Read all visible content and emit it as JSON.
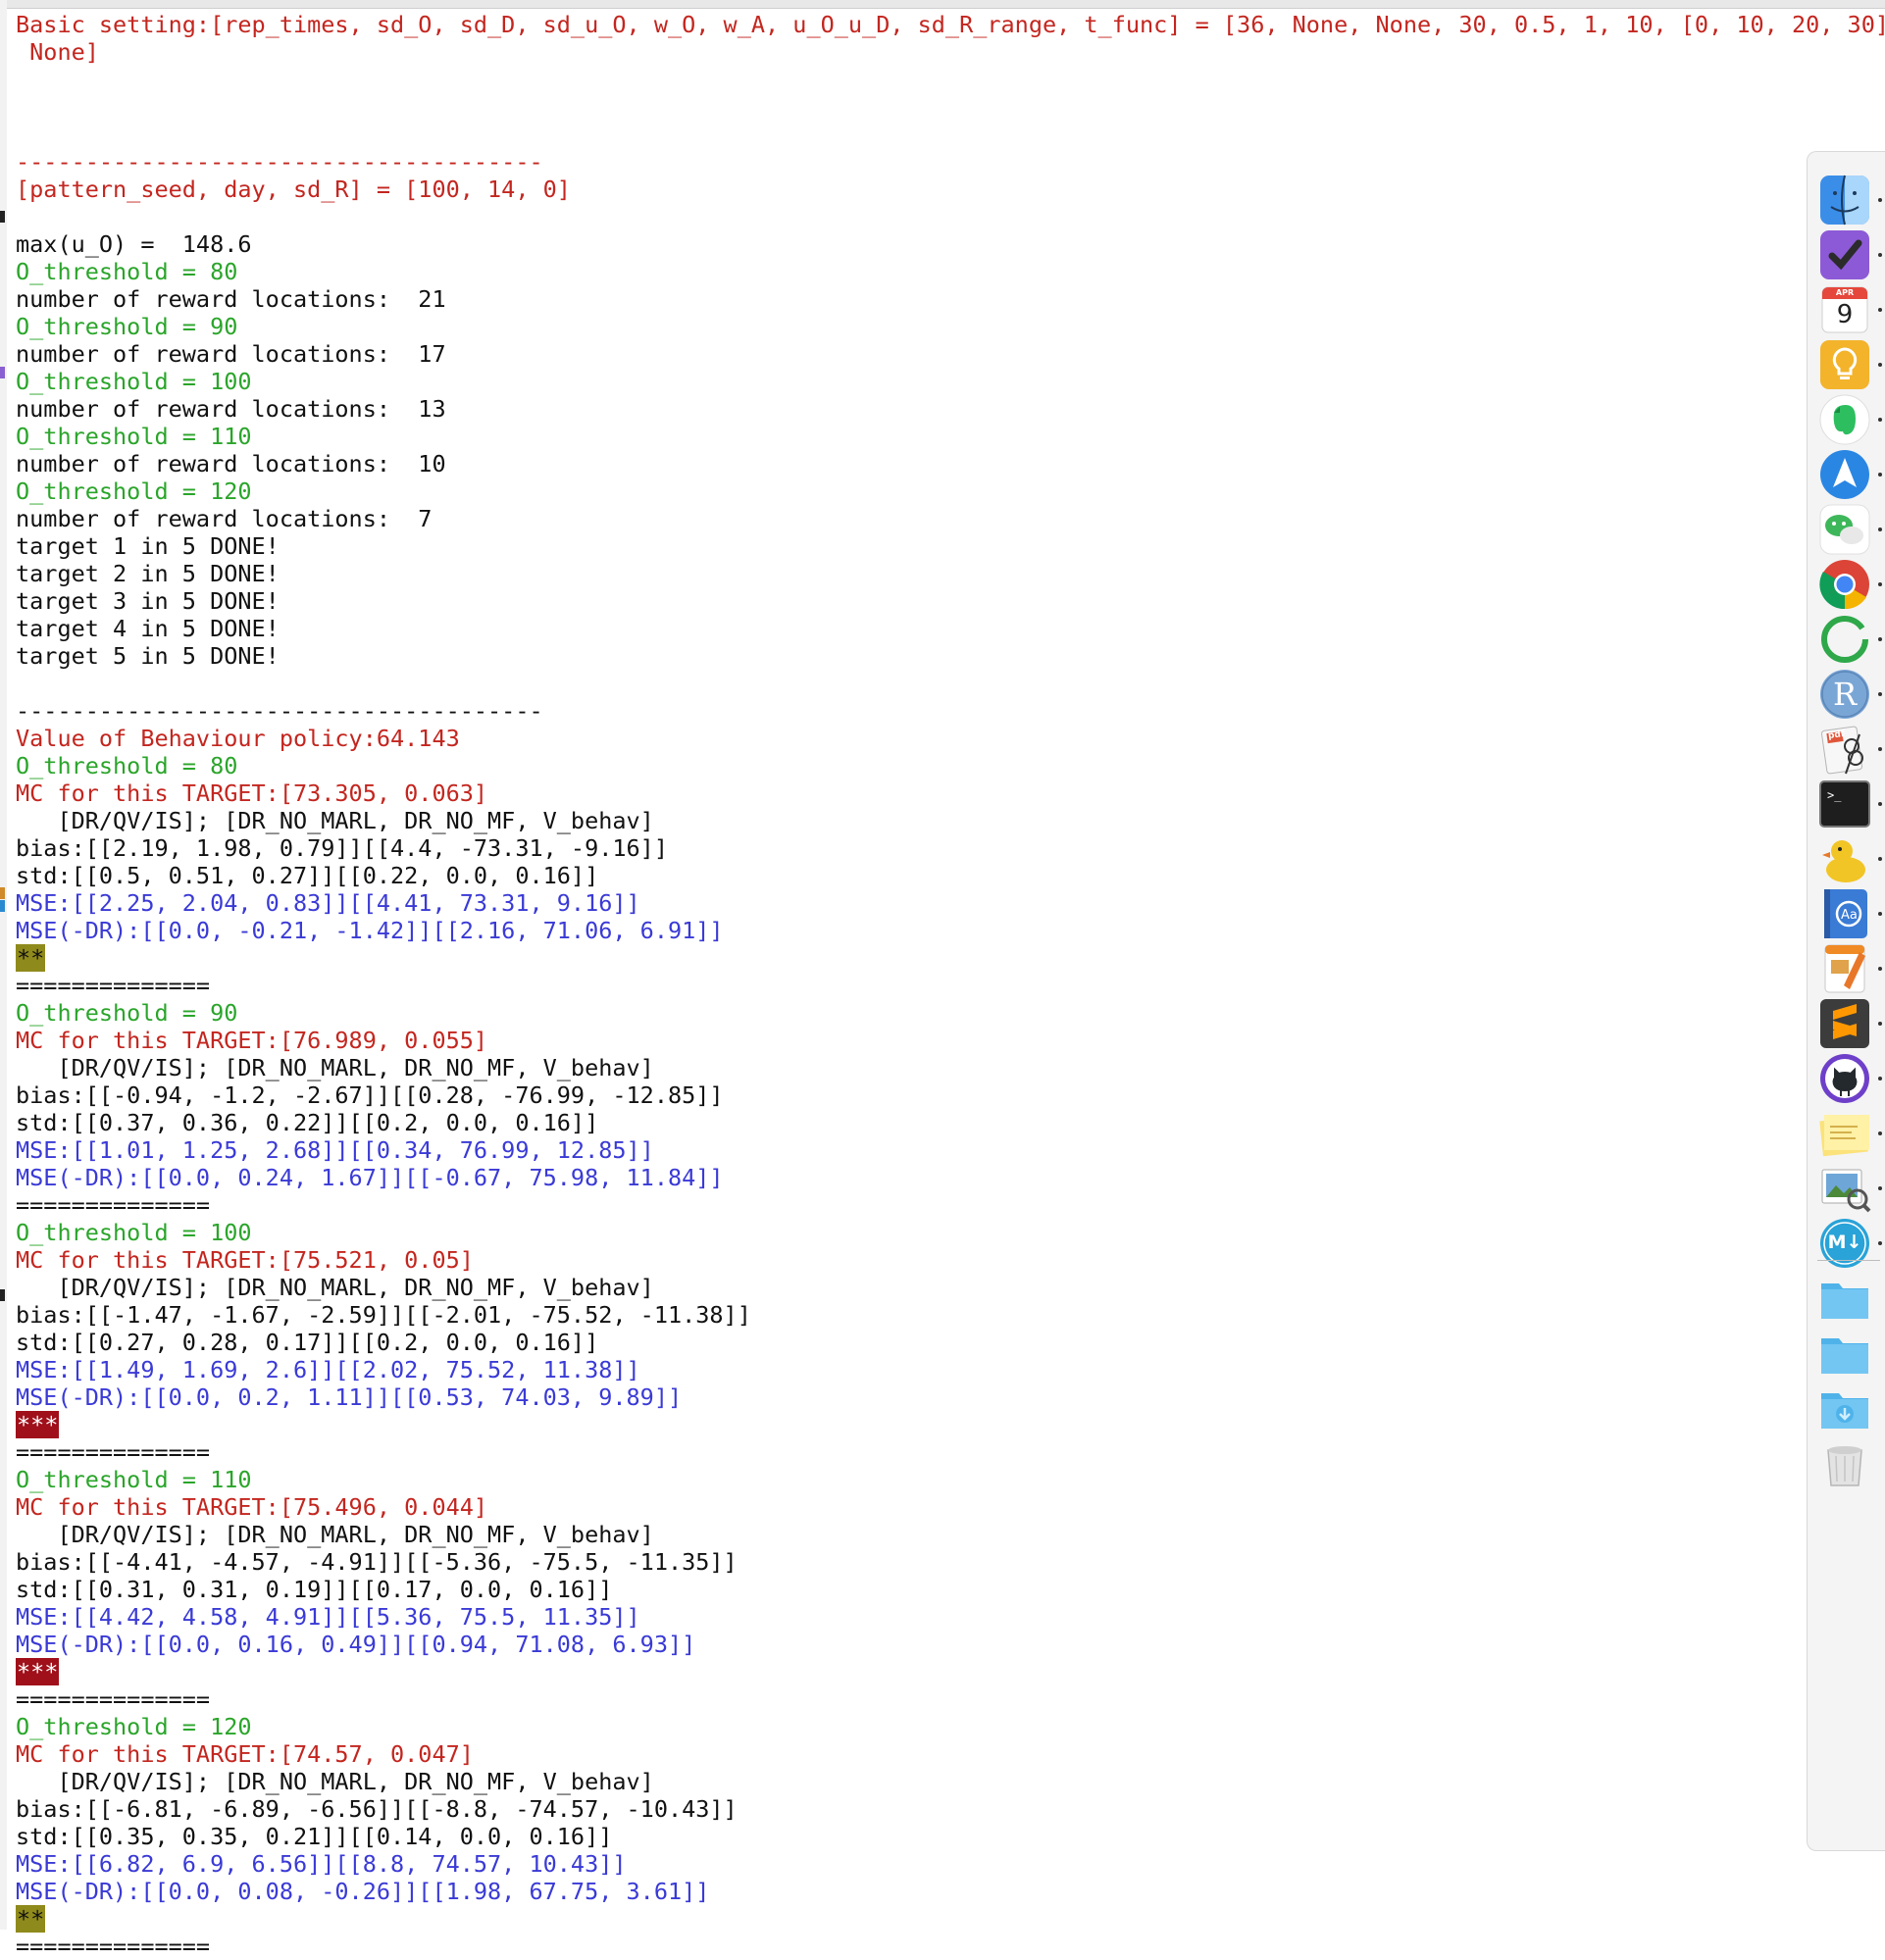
{
  "console": {
    "lines": [
      {
        "text": "Basic setting:[rep_times, sd_O, sd_D, sd_u_O, w_O, w_A, u_O_u_D, sd_R_range, t_func] = [36, None, None, 30, 0.5, 1, 10, [0, 10, 20, 30],",
        "color": "red"
      },
      {
        "text": " None]",
        "color": "red"
      },
      {
        "text": "",
        "color": "black"
      },
      {
        "text": "",
        "color": "black"
      },
      {
        "text": "",
        "color": "black"
      },
      {
        "text": "--------------------------------------",
        "color": "red"
      },
      {
        "text": "[pattern_seed, day, sd_R] = [100, 14, 0]",
        "color": "red"
      },
      {
        "text": "",
        "color": "black"
      },
      {
        "text": "max(u_O) =  148.6",
        "color": "black"
      },
      {
        "text": "O_threshold = 80",
        "color": "green"
      },
      {
        "text": "number of reward locations:  21",
        "color": "black"
      },
      {
        "text": "O_threshold = 90",
        "color": "green"
      },
      {
        "text": "number of reward locations:  17",
        "color": "black"
      },
      {
        "text": "O_threshold = 100",
        "color": "green"
      },
      {
        "text": "number of reward locations:  13",
        "color": "black"
      },
      {
        "text": "O_threshold = 110",
        "color": "green"
      },
      {
        "text": "number of reward locations:  10",
        "color": "black"
      },
      {
        "text": "O_threshold = 120",
        "color": "green"
      },
      {
        "text": "number of reward locations:  7",
        "color": "black"
      },
      {
        "text": "target 1 in 5 DONE!",
        "color": "black"
      },
      {
        "text": "target 2 in 5 DONE!",
        "color": "black"
      },
      {
        "text": "target 3 in 5 DONE!",
        "color": "black"
      },
      {
        "text": "target 4 in 5 DONE!",
        "color": "black"
      },
      {
        "text": "target 5 in 5 DONE!",
        "color": "black"
      },
      {
        "text": "",
        "color": "black"
      },
      {
        "text": "--------------------------------------",
        "color": "black"
      },
      {
        "text": "Value of Behaviour policy:64.143",
        "color": "red"
      },
      {
        "text": "O_threshold = 80",
        "color": "green"
      },
      {
        "text": "MC for this TARGET:[73.305, 0.063]",
        "color": "red"
      },
      {
        "text": "   [DR/QV/IS]; [DR_NO_MARL, DR_NO_MF, V_behav]",
        "color": "black"
      },
      {
        "text": "bias:[[2.19, 1.98, 0.79]][[4.4, -73.31, -9.16]]",
        "color": "black"
      },
      {
        "text": "std:[[0.5, 0.51, 0.27]][[0.22, 0.0, 0.16]]",
        "color": "black"
      },
      {
        "text": "MSE:[[2.25, 2.04, 0.83]][[4.41, 73.31, 9.16]]",
        "color": "blue"
      },
      {
        "text": "MSE(-DR):[[0.0, -0.21, -1.42]][[2.16, 71.06, 6.91]]",
        "color": "blue"
      },
      {
        "text": "**",
        "color": "star-olive"
      },
      {
        "text": "==============",
        "color": "black"
      },
      {
        "text": "O_threshold = 90",
        "color": "green"
      },
      {
        "text": "MC for this TARGET:[76.989, 0.055]",
        "color": "red"
      },
      {
        "text": "   [DR/QV/IS]; [DR_NO_MARL, DR_NO_MF, V_behav]",
        "color": "black"
      },
      {
        "text": "bias:[[-0.94, -1.2, -2.67]][[0.28, -76.99, -12.85]]",
        "color": "black"
      },
      {
        "text": "std:[[0.37, 0.36, 0.22]][[0.2, 0.0, 0.16]]",
        "color": "black"
      },
      {
        "text": "MSE:[[1.01, 1.25, 2.68]][[0.34, 76.99, 12.85]]",
        "color": "blue"
      },
      {
        "text": "MSE(-DR):[[0.0, 0.24, 1.67]][[-0.67, 75.98, 11.84]]",
        "color": "blue"
      },
      {
        "text": "==============",
        "color": "black"
      },
      {
        "text": "O_threshold = 100",
        "color": "green"
      },
      {
        "text": "MC for this TARGET:[75.521, 0.05]",
        "color": "red"
      },
      {
        "text": "   [DR/QV/IS]; [DR_NO_MARL, DR_NO_MF, V_behav]",
        "color": "black"
      },
      {
        "text": "bias:[[-1.47, -1.67, -2.59]][[-2.01, -75.52, -11.38]]",
        "color": "black"
      },
      {
        "text": "std:[[0.27, 0.28, 0.17]][[0.2, 0.0, 0.16]]",
        "color": "black"
      },
      {
        "text": "MSE:[[1.49, 1.69, 2.6]][[2.02, 75.52, 11.38]]",
        "color": "blue"
      },
      {
        "text": "MSE(-DR):[[0.0, 0.2, 1.11]][[0.53, 74.03, 9.89]]",
        "color": "blue"
      },
      {
        "text": "***",
        "color": "star-maroon"
      },
      {
        "text": "==============",
        "color": "black"
      },
      {
        "text": "O_threshold = 110",
        "color": "green"
      },
      {
        "text": "MC for this TARGET:[75.496, 0.044]",
        "color": "red"
      },
      {
        "text": "   [DR/QV/IS]; [DR_NO_MARL, DR_NO_MF, V_behav]",
        "color": "black"
      },
      {
        "text": "bias:[[-4.41, -4.57, -4.91]][[-5.36, -75.5, -11.35]]",
        "color": "black"
      },
      {
        "text": "std:[[0.31, 0.31, 0.19]][[0.17, 0.0, 0.16]]",
        "color": "black"
      },
      {
        "text": "MSE:[[4.42, 4.58, 4.91]][[5.36, 75.5, 11.35]]",
        "color": "blue"
      },
      {
        "text": "MSE(-DR):[[0.0, 0.16, 0.49]][[0.94, 71.08, 6.93]]",
        "color": "blue"
      },
      {
        "text": "***",
        "color": "star-maroon"
      },
      {
        "text": "==============",
        "color": "black"
      },
      {
        "text": "O_threshold = 120",
        "color": "green"
      },
      {
        "text": "MC for this TARGET:[74.57, 0.047]",
        "color": "red"
      },
      {
        "text": "   [DR/QV/IS]; [DR_NO_MARL, DR_NO_MF, V_behav]",
        "color": "black"
      },
      {
        "text": "bias:[[-6.81, -6.89, -6.56]][[-8.8, -74.57, -10.43]]",
        "color": "black"
      },
      {
        "text": "std:[[0.35, 0.35, 0.21]][[0.14, 0.0, 0.16]]",
        "color": "black"
      },
      {
        "text": "MSE:[[6.82, 6.9, 6.56]][[8.8, 74.57, 10.43]]",
        "color": "blue"
      },
      {
        "text": "MSE(-DR):[[0.0, 0.08, -0.26]][[1.98, 67.75, 3.61]]",
        "color": "blue"
      },
      {
        "text": "**",
        "color": "star-olive"
      },
      {
        "text": "==============",
        "color": "black"
      }
    ]
  },
  "dock": {
    "calendar_month": "APR",
    "calendar_day": "9",
    "r_letter": "R",
    "pdf_label": "pdf",
    "md_label": "M↓",
    "apps": [
      {
        "name": "finder-icon",
        "running": true
      },
      {
        "name": "omnifocus-icon",
        "running": true
      },
      {
        "name": "calendar-icon",
        "running": true
      },
      {
        "name": "tips-icon",
        "running": true
      },
      {
        "name": "evernote-icon",
        "running": true
      },
      {
        "name": "spark-mail-icon",
        "running": true
      },
      {
        "name": "wechat-icon",
        "running": true
      },
      {
        "name": "chrome-icon",
        "running": true
      },
      {
        "name": "sync-ring-icon",
        "running": true
      },
      {
        "name": "r-icon",
        "running": true
      },
      {
        "name": "pdf-reader-icon",
        "running": true
      },
      {
        "name": "terminal-icon",
        "running": true
      },
      {
        "name": "cyberduck-icon",
        "running": true
      },
      {
        "name": "dictionary-icon",
        "running": true
      },
      {
        "name": "pages-icon",
        "running": true
      },
      {
        "name": "sublime-text-icon",
        "running": true
      },
      {
        "name": "github-desktop-icon",
        "running": true
      },
      {
        "name": "stickies-icon",
        "running": true
      },
      {
        "name": "preview-icon",
        "running": true
      },
      {
        "name": "markdown-editor-icon",
        "running": true
      },
      {
        "name": "folder-icon",
        "running": false
      },
      {
        "name": "folder-icon",
        "running": false
      },
      {
        "name": "downloads-folder-icon",
        "running": false
      },
      {
        "name": "trash-icon",
        "running": false
      }
    ]
  },
  "colors": {
    "red": "#c3261f",
    "green": "#2aa52a",
    "blue": "#3a3ad6",
    "black": "#111111",
    "star_olive": "#8f8a1c",
    "star_maroon": "#a0101a"
  }
}
